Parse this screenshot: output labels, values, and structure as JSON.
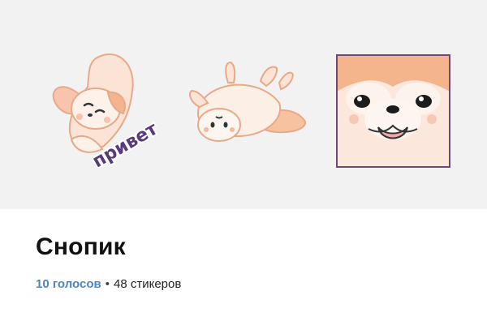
{
  "pack": {
    "title": "Снопик",
    "votes": "10 голосов",
    "separator": "•",
    "sticker_count": "48 стикеров"
  },
  "stickers": [
    {
      "name": "fox-hello",
      "caption": "привет"
    },
    {
      "name": "fox-lying-upside-down"
    },
    {
      "name": "dog-face-closeup"
    }
  ],
  "colors": {
    "preview_bg": "#f2f2f2",
    "votes_link": "#4a86c8",
    "fur_orange": "#f4b58c",
    "fur_cream": "#fdeee4",
    "caption_purple": "#5a3a7a"
  }
}
